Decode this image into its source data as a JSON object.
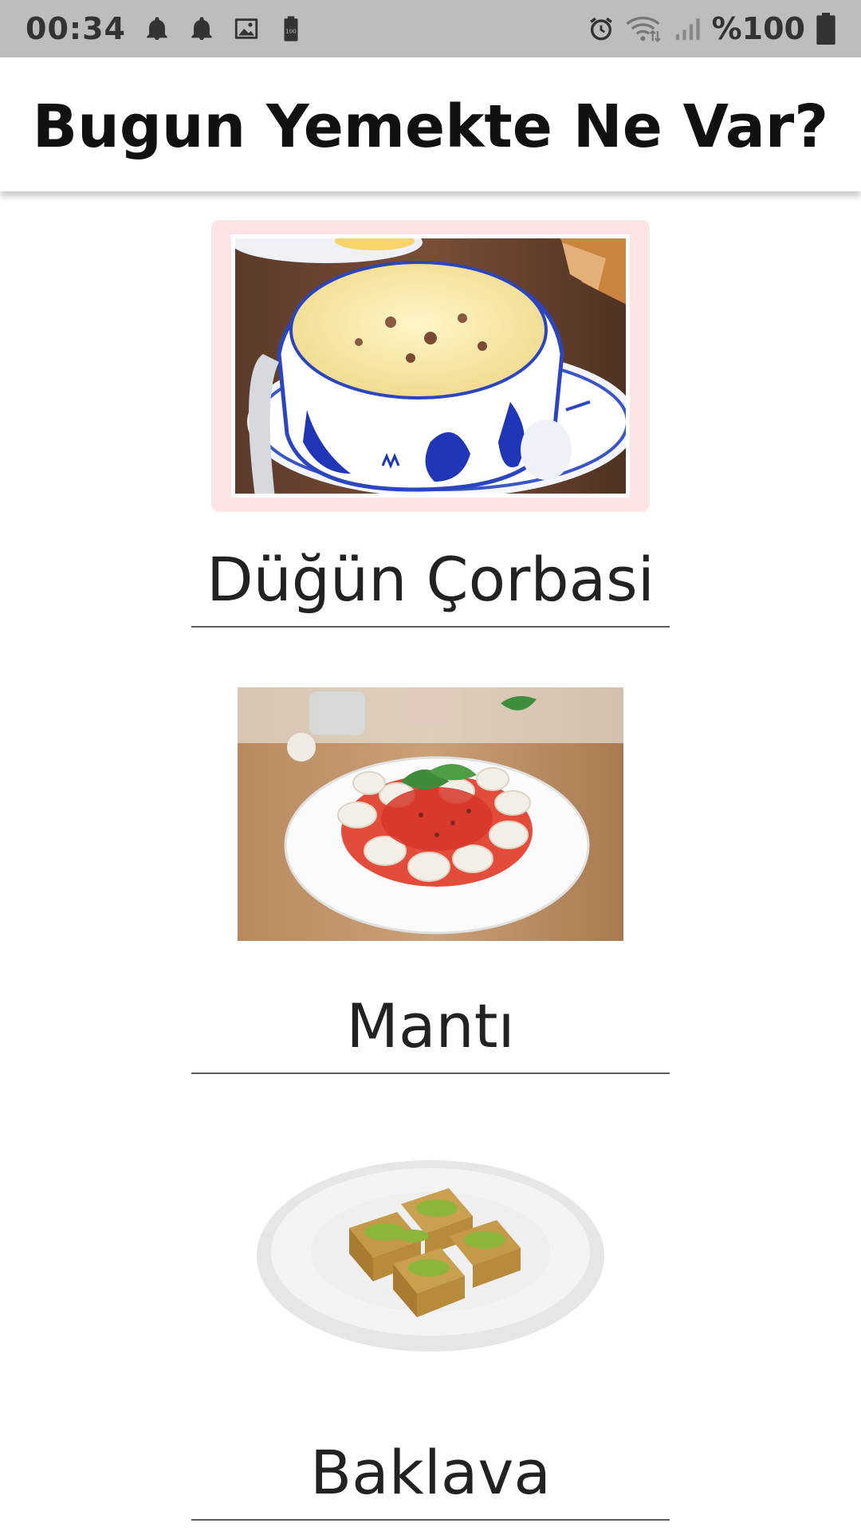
{
  "status_bar": {
    "time": "00:34",
    "battery_percent": "%100",
    "icons": [
      "bell-icon",
      "bell-icon",
      "image-icon",
      "battery-saver-icon",
      "alarm-icon",
      "wifi-icon",
      "signal-icon",
      "battery-icon"
    ]
  },
  "app_bar": {
    "title": "Bugun Yemekte Ne Var?"
  },
  "menu": {
    "items": [
      {
        "name": "Düğün Çorbasi"
      },
      {
        "name": "Mantı"
      },
      {
        "name": "Baklava"
      }
    ]
  },
  "colors": {
    "status_bar_bg": "#bdbdbd",
    "highlight_frame": "#fde4e4",
    "divider": "#5f5f5f"
  }
}
